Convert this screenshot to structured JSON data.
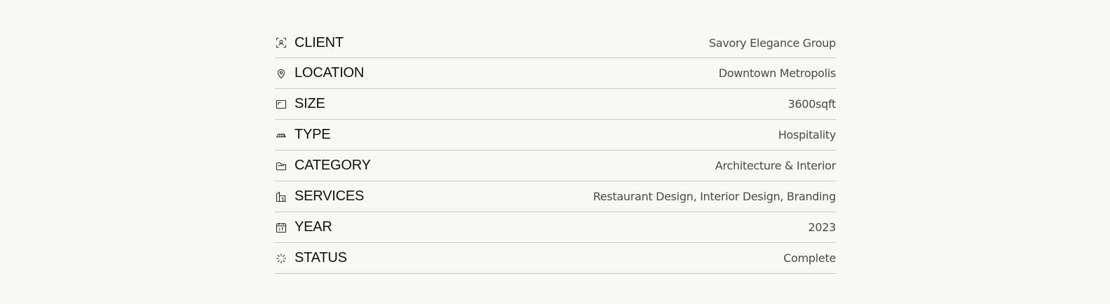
{
  "details": [
    {
      "icon": "client-icon",
      "label": "CLIENT",
      "value": "Savory Elegance Group"
    },
    {
      "icon": "location-pin-icon",
      "label": "LOCATION",
      "value": "Downtown Metropolis"
    },
    {
      "icon": "size-icon",
      "label": "SIZE",
      "value": "3600sqft"
    },
    {
      "icon": "type-icon",
      "label": "TYPE",
      "value": "Hospitality"
    },
    {
      "icon": "folder-icon",
      "label": "CATEGORY",
      "value": "Architecture & Interior"
    },
    {
      "icon": "building-icon",
      "label": "SERVICES",
      "value": "Restaurant Design, Interior Design, Branding"
    },
    {
      "icon": "calendar-icon",
      "label": "YEAR",
      "value": "2023"
    },
    {
      "icon": "loading-icon",
      "label": "STATUS",
      "value": "Complete"
    }
  ],
  "colors": {
    "background": "#f8f8f7",
    "label": "#111111",
    "value": "#4a4a4a",
    "divider": "#c9c9c9"
  }
}
